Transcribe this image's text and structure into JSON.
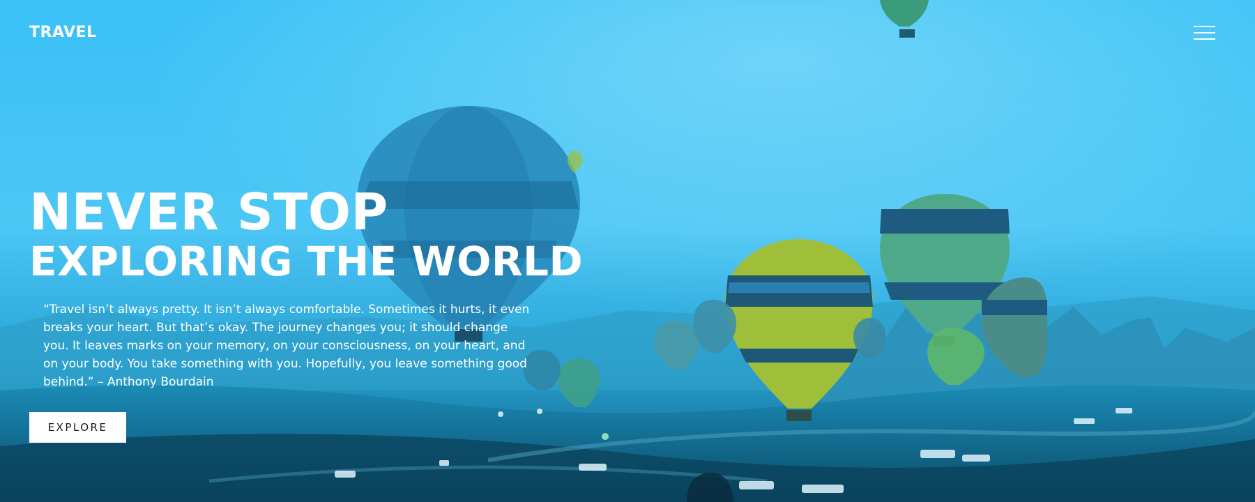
{
  "header": {
    "brand": "TRAVEL",
    "menu_icon": "hamburger-menu-icon"
  },
  "hero": {
    "headline_line1": "NEVER STOP",
    "headline_line2": "EXPLORING THE WORLD",
    "quote": "“Travel isn’t always pretty. It isn’t always comfortable. Sometimes it hurts, it even breaks your heart. But that’s okay. The journey changes you; it should change you. It leaves marks on your memory, on your consciousness, on your heart, and on your body. You take something with you. Hopefully, you leave something good behind.” – Anthony Bourdain",
    "cta_label": "EXPLORE"
  },
  "colors": {
    "sky": "#3fc4f5",
    "ground": "#0f5a7a",
    "text": "#ffffff",
    "button_bg": "#ffffff",
    "button_text": "#1a1a1a"
  }
}
